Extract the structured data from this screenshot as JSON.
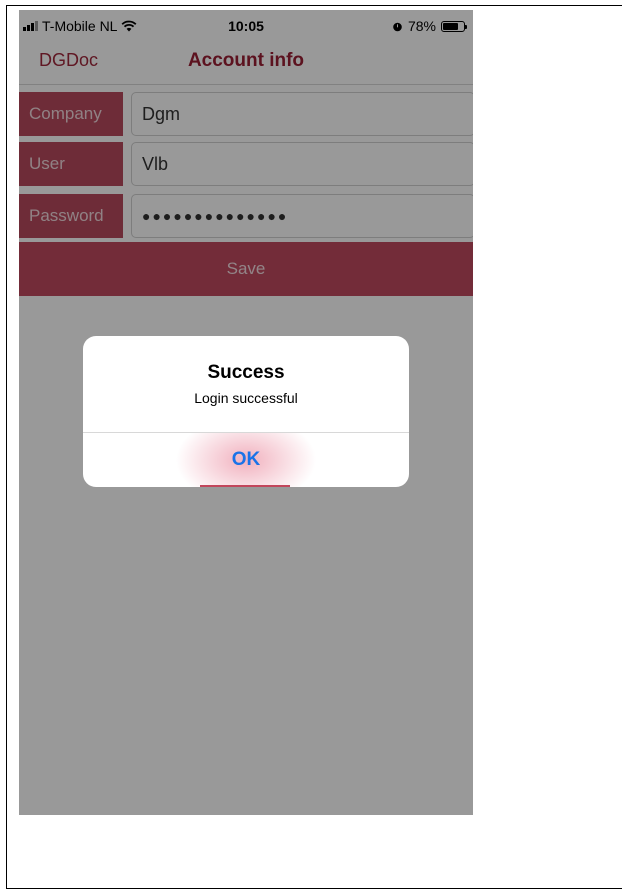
{
  "status_bar": {
    "carrier": "T-Mobile NL",
    "time": "10:05",
    "battery": "78%",
    "battery_level": 0.78,
    "icons": [
      "signal-icon",
      "wifi-icon",
      "alarm-icon",
      "battery-icon"
    ]
  },
  "nav": {
    "back_label": "DGDoc",
    "title": "Account info"
  },
  "form": {
    "fields": [
      {
        "label": "Company",
        "value": "Dgm"
      },
      {
        "label": "User",
        "value": "Vlb"
      },
      {
        "label": "Password",
        "value": "●●●●●●●●●●●●●●"
      }
    ],
    "save_label": "Save"
  },
  "alert": {
    "title": "Success",
    "message": "Login successful",
    "ok_label": "OK"
  },
  "colors": {
    "brand": "#a0283c",
    "label_bg": "#b84a5e",
    "button_bg": "#c04a60",
    "link_blue": "#1a73e8"
  }
}
